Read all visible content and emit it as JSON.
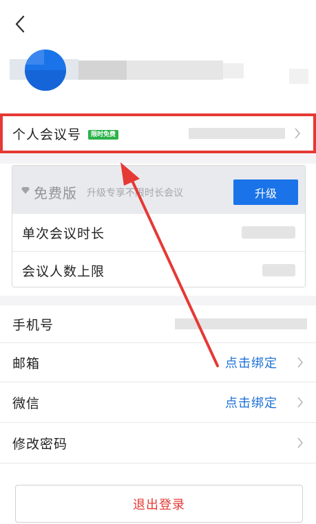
{
  "header": {
    "back_icon": "chevron-left-icon"
  },
  "profile": {
    "avatar_color": "#1a73e8"
  },
  "personal_meeting": {
    "label": "个人会议号",
    "badge": "限时免费",
    "badge_color": "#2cb34a",
    "highlight_color": "#e53935"
  },
  "plan": {
    "icon": "diamond-icon",
    "title": "免费版",
    "subtitle": "升级专享不限时长会议",
    "upgrade_label": "升级",
    "rows": [
      {
        "label": "单次会议时长"
      },
      {
        "label": "会议人数上限"
      }
    ]
  },
  "account": {
    "rows": [
      {
        "label": "手机号",
        "action": ""
      },
      {
        "label": "邮箱",
        "action": "点击绑定"
      },
      {
        "label": "微信",
        "action": "点击绑定"
      },
      {
        "label": "修改密码",
        "action": ""
      }
    ]
  },
  "logout_label": "退出登录",
  "accent_color": "#1a73e8",
  "danger_color": "#e53935",
  "annotation_arrow_color": "#e53935"
}
